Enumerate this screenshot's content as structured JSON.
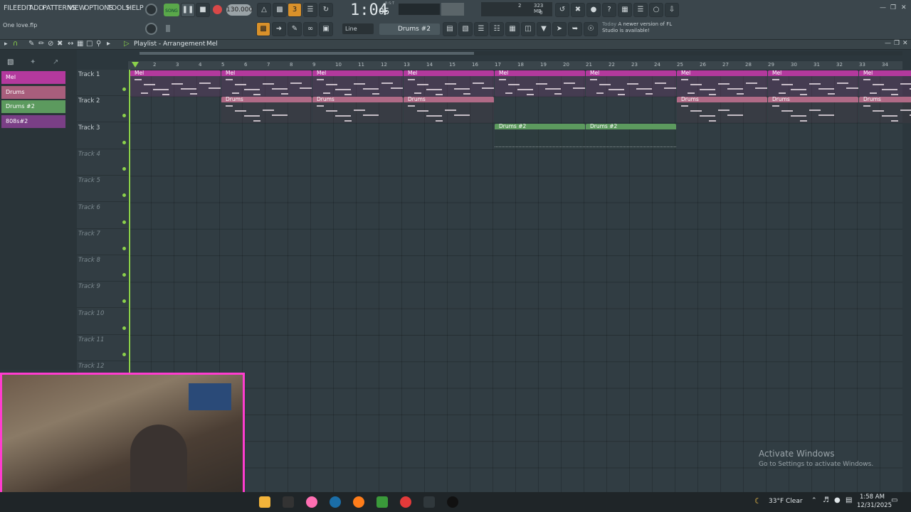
{
  "menu": [
    "FILE",
    "EDIT",
    "ADD",
    "PATTERNS",
    "VIEW",
    "OPTIONS",
    "TOOLS",
    "HELP"
  ],
  "transport": {
    "mode": "SONG",
    "tempo": "130.000",
    "time": "1:04",
    "time_small": "05",
    "time_unit": "B:S:T"
  },
  "cpu": {
    "memory": "323 MB",
    "polyphony": "2",
    "zero": "0"
  },
  "project_file": "One love.flp",
  "snap": "Line",
  "current_pattern": "Drums #2",
  "news": {
    "day": "Today",
    "text": "A newer version of FL Studio is available!"
  },
  "playlist": {
    "title": "Playlist - Arrangement",
    "breadcrumb": "Mel"
  },
  "patterns": [
    {
      "name": "Mel",
      "color": "#b3399d"
    },
    {
      "name": "Drums",
      "color": "#a85e7c"
    },
    {
      "name": "Drums #2",
      "color": "#5c9a5e"
    },
    {
      "name": "808s#2",
      "color": "#7a3f86"
    }
  ],
  "ruler": [
    "2",
    "3",
    "4",
    "5",
    "6",
    "7",
    "8",
    "9",
    "10",
    "11",
    "12",
    "13",
    "14",
    "15",
    "16",
    "17",
    "18",
    "19",
    "20",
    "21",
    "22",
    "23",
    "24",
    "25",
    "26",
    "27",
    "28",
    "29",
    "30",
    "31",
    "32",
    "33",
    "34"
  ],
  "tracks": [
    "Track 1",
    "Track 2",
    "Track 3",
    "Track 4",
    "Track 5",
    "Track 6",
    "Track 7",
    "Track 8",
    "Track 9",
    "Track 10",
    "Track 11",
    "Track 12"
  ],
  "clips": {
    "mel": [
      "Mel",
      "Mel",
      "Mel",
      "Mel",
      "Mel",
      "Mel",
      "Mel",
      "Mel",
      "Mel",
      "Mel"
    ],
    "drums": [
      "Drums",
      "Drums",
      "Drums",
      "Drums",
      "Drums",
      "Drums"
    ],
    "drums2": [
      "Drums #2",
      "Drums #2"
    ]
  },
  "watermark": {
    "title": "Activate Windows",
    "subtitle": "Go to Settings to activate Windows."
  },
  "taskbar": {
    "weather": "33°F",
    "condition": "Clear",
    "time": "1:58 AM",
    "date": "12/31/2025"
  }
}
